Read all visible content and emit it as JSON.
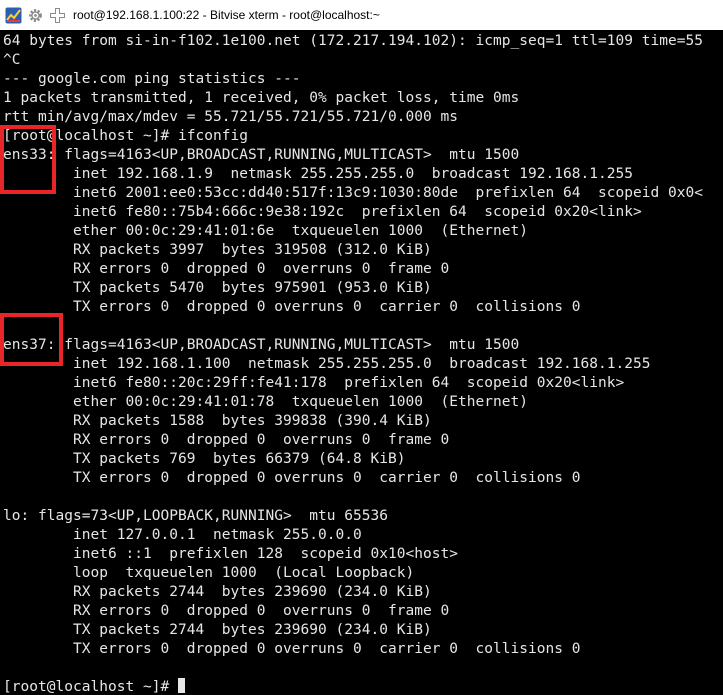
{
  "window": {
    "title": "root@192.168.1.100:22 - Bitvise xterm - root@localhost:~"
  },
  "icons": {
    "app": "bitvise-app-icon",
    "settings": "gear-icon",
    "move": "move-cross-icon"
  },
  "colors": {
    "background": "#000000",
    "text": "#e6e6e6",
    "highlight": "#e8262a"
  },
  "terminal": {
    "lines": [
      "64 bytes from si-in-f102.1e100.net (172.217.194.102): icmp_seq=1 ttl=109 time=55",
      "^C",
      "--- google.com ping statistics ---",
      "1 packets transmitted, 1 received, 0% packet loss, time 0ms",
      "rtt min/avg/max/mdev = 55.721/55.721/55.721/0.000 ms",
      "[root@localhost ~]# ifconfig",
      "ens33: flags=4163<UP,BROADCAST,RUNNING,MULTICAST>  mtu 1500",
      "        inet 192.168.1.9  netmask 255.255.255.0  broadcast 192.168.1.255",
      "        inet6 2001:ee0:53cc:dd40:517f:13c9:1030:80de  prefixlen 64  scopeid 0x0<",
      "        inet6 fe80::75b4:666c:9e38:192c  prefixlen 64  scopeid 0x20<link>",
      "        ether 00:0c:29:41:01:6e  txqueuelen 1000  (Ethernet)",
      "        RX packets 3997  bytes 319508 (312.0 KiB)",
      "        RX errors 0  dropped 0  overruns 0  frame 0",
      "        TX packets 5470  bytes 975901 (953.0 KiB)",
      "        TX errors 0  dropped 0 overruns 0  carrier 0  collisions 0",
      "",
      "ens37: flags=4163<UP,BROADCAST,RUNNING,MULTICAST>  mtu 1500",
      "        inet 192.168.1.100  netmask 255.255.255.0  broadcast 192.168.1.255",
      "        inet6 fe80::20c:29ff:fe41:178  prefixlen 64  scopeid 0x20<link>",
      "        ether 00:0c:29:41:01:78  txqueuelen 1000  (Ethernet)",
      "        RX packets 1588  bytes 399838 (390.4 KiB)",
      "        RX errors 0  dropped 0  overruns 0  frame 0",
      "        TX packets 769  bytes 66379 (64.8 KiB)",
      "        TX errors 0  dropped 0 overruns 0  carrier 0  collisions 0",
      "",
      "lo: flags=73<UP,LOOPBACK,RUNNING>  mtu 65536",
      "        inet 127.0.0.1  netmask 255.0.0.0",
      "        inet6 ::1  prefixlen 128  scopeid 0x10<host>",
      "        loop  txqueuelen 1000  (Local Loopback)",
      "        RX packets 2744  bytes 239690 (234.0 KiB)",
      "        RX errors 0  dropped 0  overruns 0  frame 0",
      "        TX packets 2744  bytes 239690 (234.0 KiB)",
      "        TX errors 0  dropped 0 overruns 0  carrier 0  collisions 0",
      "",
      "[root@localhost ~]# "
    ]
  }
}
